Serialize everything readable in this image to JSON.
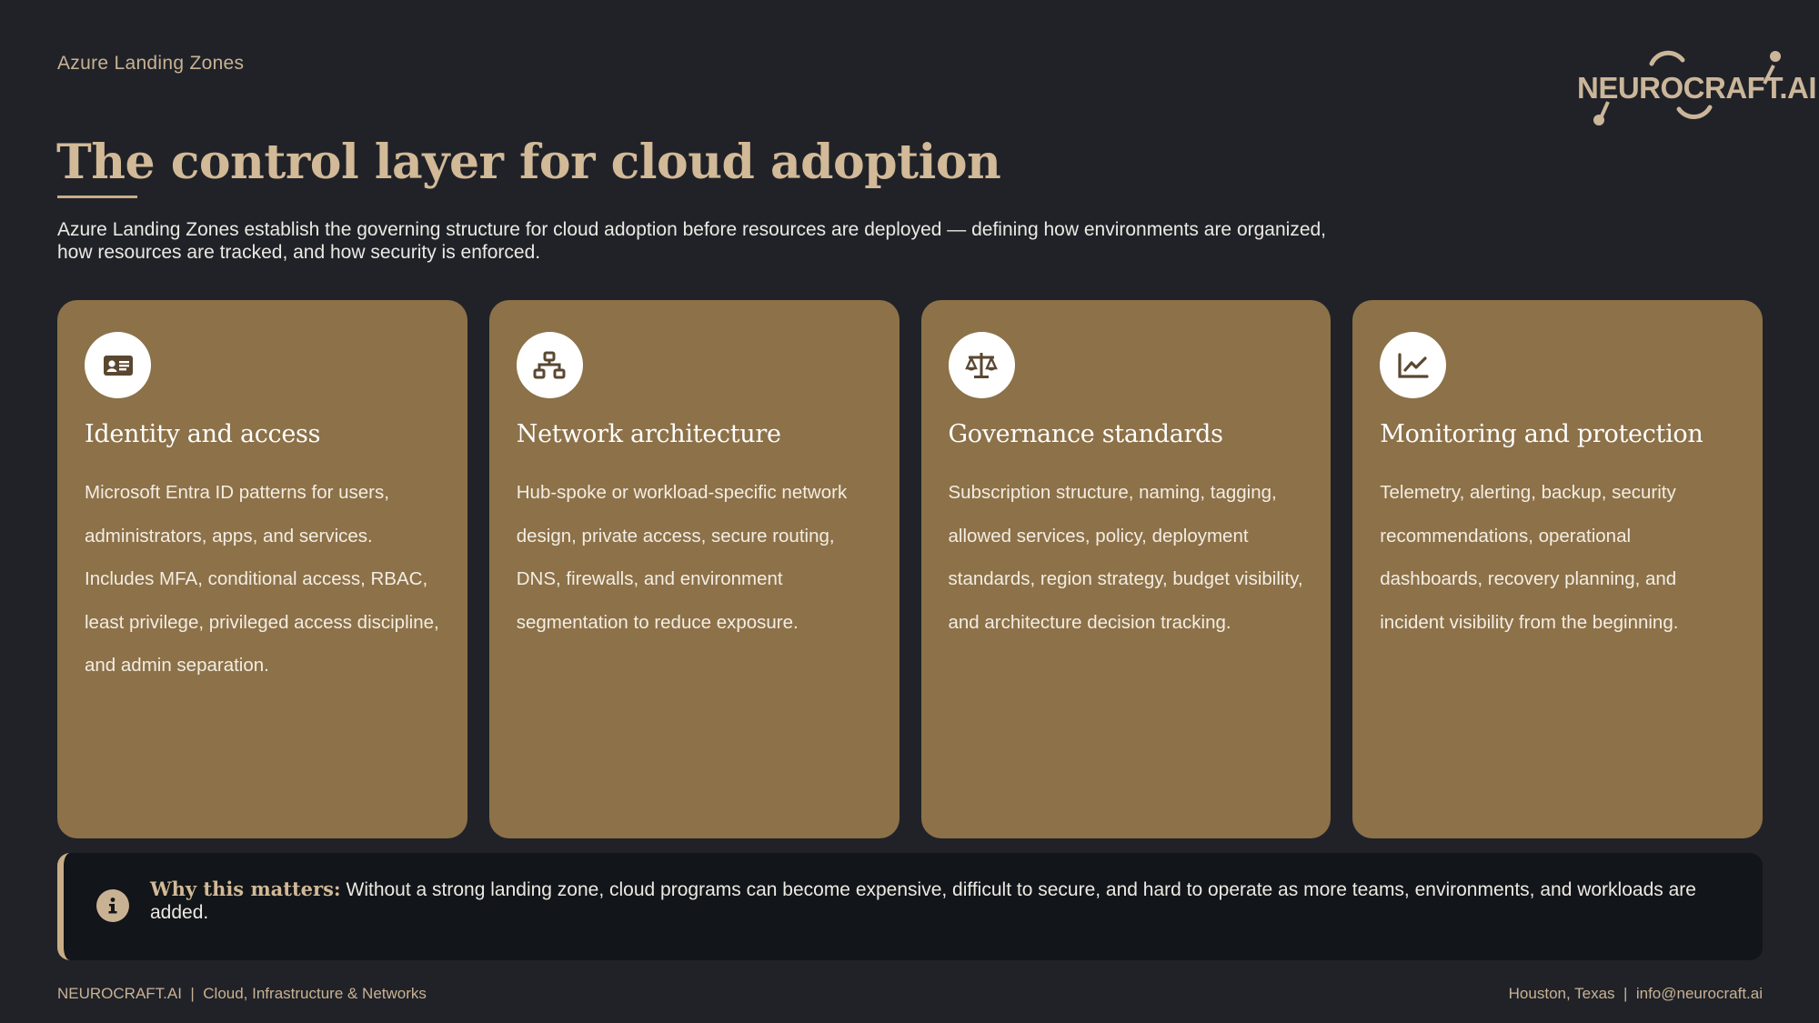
{
  "header": {
    "eyebrow": "Azure Landing Zones",
    "title": "The control layer for cloud adoption",
    "intro": "Azure Landing Zones establish the governing structure for cloud adoption before resources are deployed — defining how environments are organized, how resources are tracked, and how security is enforced."
  },
  "logo": {
    "text": "NEUROCRAFT.AI"
  },
  "cards": [
    {
      "icon": "id-card-icon",
      "title": "Identity and access",
      "body": "Microsoft Entra ID patterns for users, administrators, apps, and services. Includes MFA, conditional access, RBAC, least privilege, privileged access discipline, and admin separation."
    },
    {
      "icon": "network-icon",
      "title": "Network architecture",
      "body": "Hub-spoke or workload-specific network design, private access, secure routing, DNS, firewalls, and environment segmentation to reduce exposure."
    },
    {
      "icon": "scales-icon",
      "title": "Governance standards",
      "body": "Subscription structure, naming, tagging, allowed services, policy, deployment standards, region strategy, budget visibility, and architecture decision tracking."
    },
    {
      "icon": "chart-line-icon",
      "title": "Monitoring and protection",
      "body": "Telemetry, alerting, backup, security recommendations, operational dashboards, recovery planning, and incident visibility from the beginning."
    }
  ],
  "callout": {
    "icon": "info-icon",
    "label": "Why this matters:",
    "text": " Without a strong landing zone, cloud programs can become expensive, difficult to secure, and hard to operate as more teams, environments, and workloads are added."
  },
  "footer": {
    "left": "NEUROCRAFT.AI  |  Cloud, Infrastructure & Networks",
    "right": "Houston, Texas  |  info@neurocraft.ai"
  },
  "colors": {
    "background": "#202228",
    "accent": "#c9ad87",
    "card": "#8c7149",
    "callout_bg": "#121519"
  }
}
